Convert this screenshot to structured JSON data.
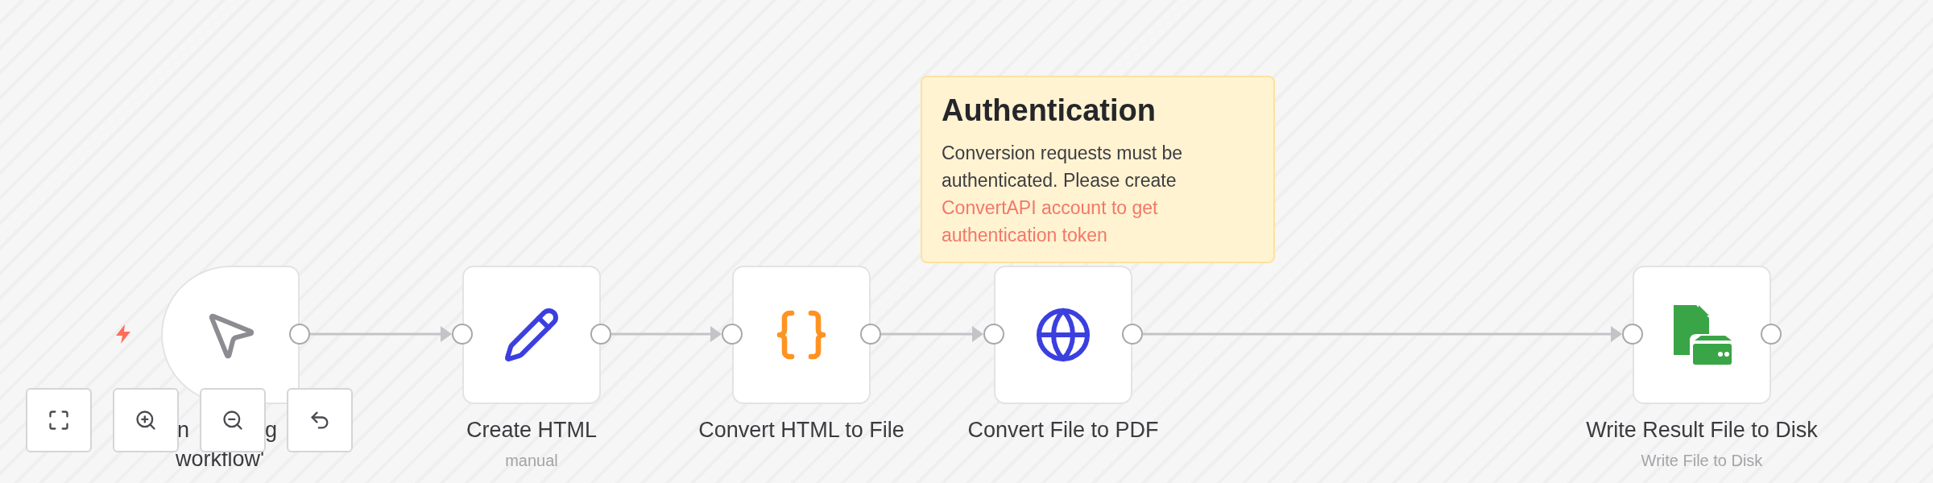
{
  "nodes": [
    {
      "kind": "trigger",
      "label_fragments": [
        "n",
        "g"
      ],
      "label_last_line": "workflow'"
    },
    {
      "kind": "set",
      "title": "Create HTML",
      "subtitle": "manual"
    },
    {
      "kind": "code",
      "title": "Convert HTML to File"
    },
    {
      "kind": "http",
      "title": "Convert File to PDF"
    },
    {
      "kind": "write_file",
      "title": "Write Result File to Disk",
      "subtitle": "Write File to Disk"
    }
  ],
  "sticky_note": {
    "title": "Authentication",
    "text": "Conversion requests must be authenticated. Please create",
    "link": "ConvertAPI account to get authentication token"
  },
  "controls": [
    {
      "kind": "fit"
    },
    {
      "kind": "zoom_in"
    },
    {
      "kind": "zoom_out"
    },
    {
      "kind": "reset"
    }
  ]
}
